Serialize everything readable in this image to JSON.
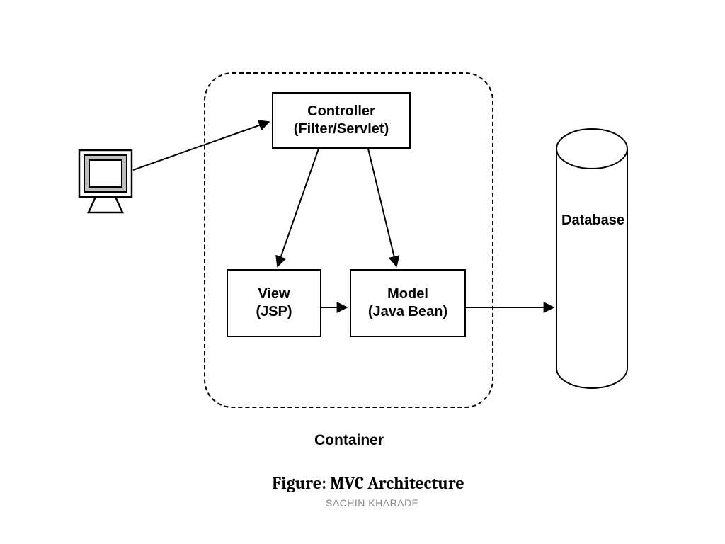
{
  "boxes": {
    "controller": {
      "line1": "Controller",
      "line2": "(Filter/Servlet)"
    },
    "view": {
      "line1": "View",
      "line2": "(JSP)"
    },
    "model": {
      "line1": "Model",
      "line2": "(Java Bean)"
    }
  },
  "labels": {
    "database": "Database",
    "container": "Container",
    "figure": "Figure: MVC Architecture",
    "author": "SACHIN KHARADE"
  }
}
